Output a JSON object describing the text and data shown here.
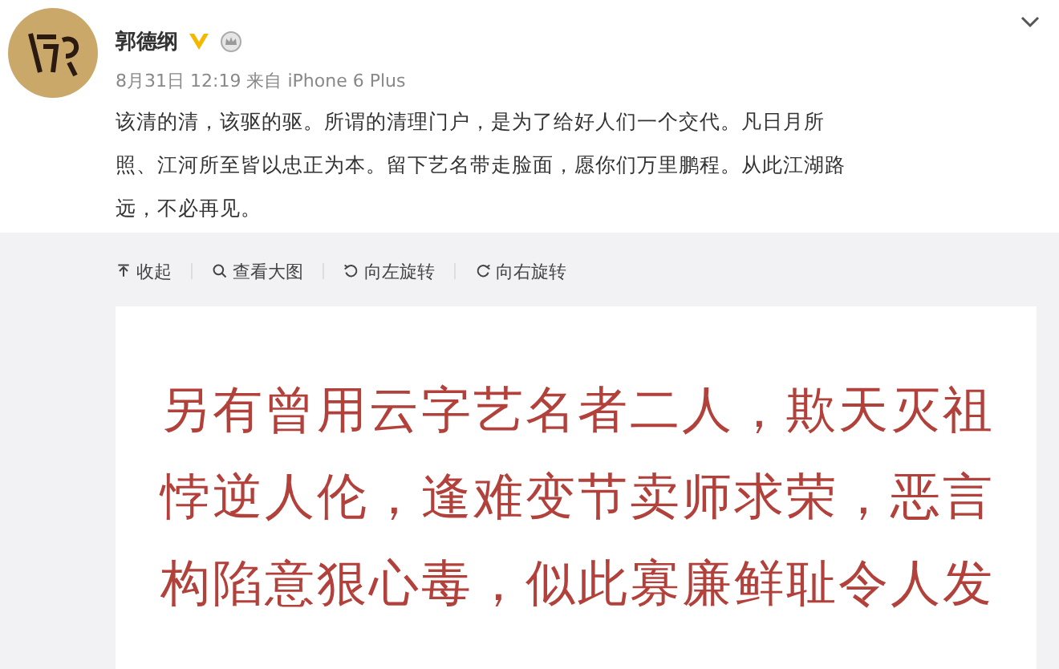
{
  "post": {
    "author": "郭德纲",
    "verified": true,
    "time": "8月31日 12:19",
    "source_prefix": "来自",
    "source": "iPhone 6 Plus",
    "text_lines": [
      "该清的清，该驱的驱。所谓的清理门户，是为了给好人们一个交代。凡日月所",
      "照、江河所至皆以忠正为本。留下艺名带走脸面，愿你们万里鹏程。从此江湖路",
      "远，不必再见。"
    ]
  },
  "image_toolbar": [
    {
      "kind": "collapse",
      "label": "收起"
    },
    {
      "kind": "zoom",
      "label": "查看大图"
    },
    {
      "kind": "rotate_left",
      "label": "向左旋转"
    },
    {
      "kind": "rotate_right",
      "label": "向右旋转"
    }
  ],
  "image_text_lines": [
    "另有曾用云字艺名者二人，欺天灭祖",
    "悖逆人伦，逢难变节卖师求荣，恶言",
    "构陷意狠心毒，似此寡廉鲜耻令人发"
  ]
}
